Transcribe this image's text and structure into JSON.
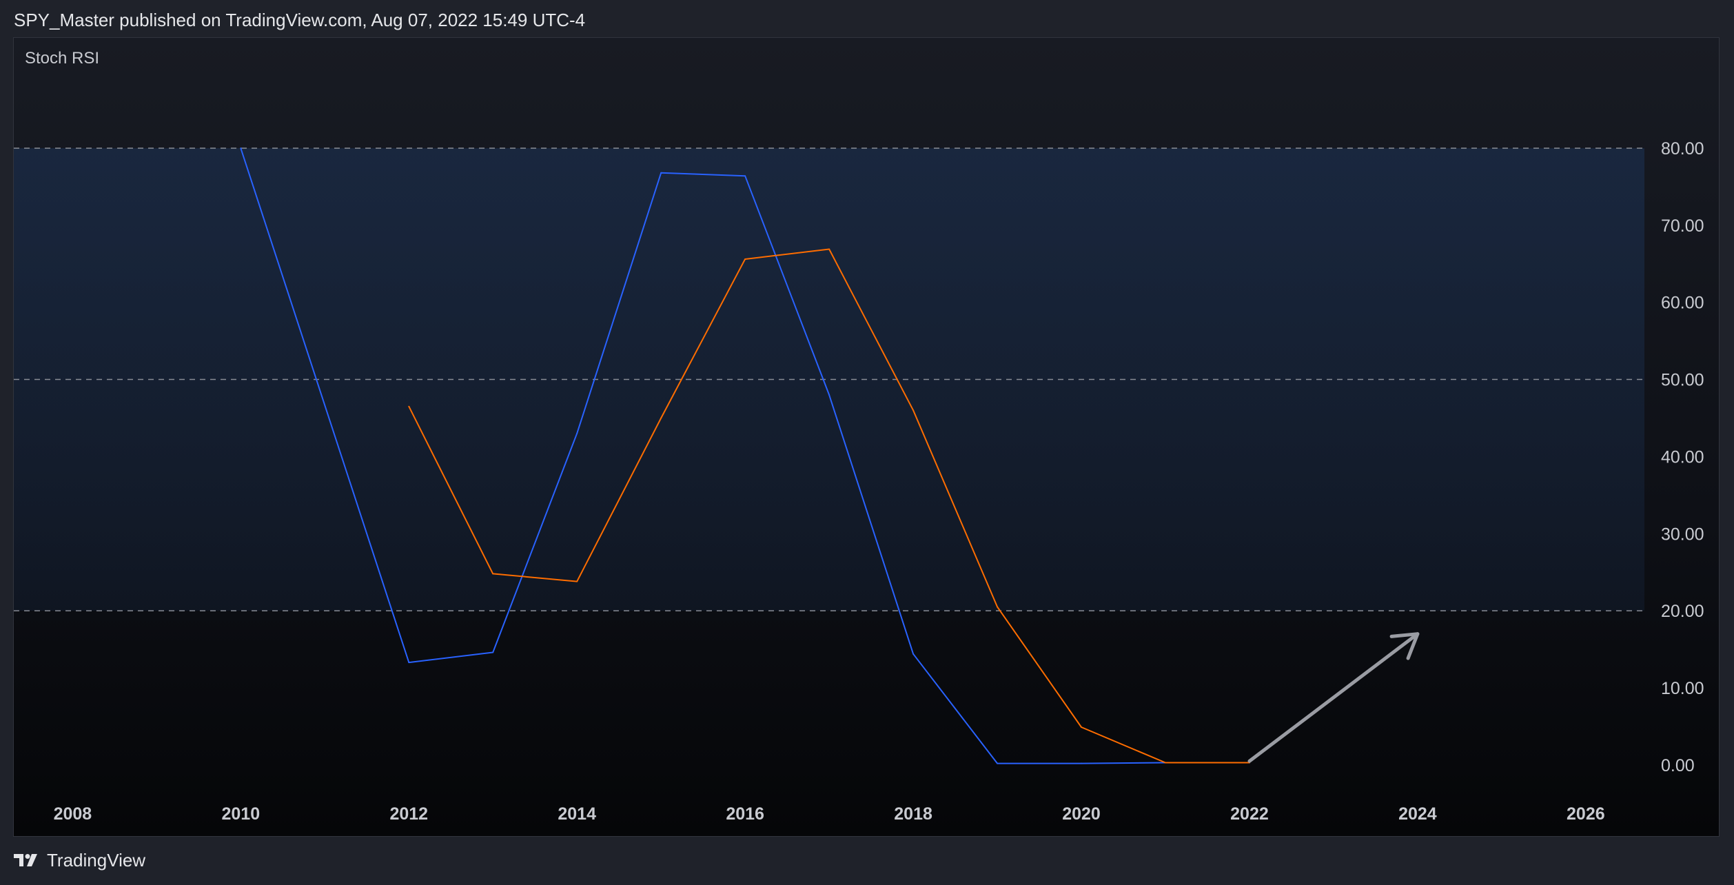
{
  "header": {
    "text": "SPY_Master published on TradingView.com, Aug 07, 2022 15:49 UTC-4"
  },
  "indicator": {
    "label": "Stoch RSI"
  },
  "footer": {
    "logo_icon": "tradingview-logo-icon",
    "brand": "TradingView"
  },
  "colors": {
    "k_line": "#2962ff",
    "d_line": "#ff6d00",
    "band_fill": "#1c3357",
    "dashed_lines": "#8a8d96",
    "arrow": "#9a9ca3",
    "axis_text": "#c9cbd1"
  },
  "chart_data": {
    "type": "line",
    "title": "Stoch RSI",
    "xlabel": "",
    "ylabel": "",
    "xlim": [
      2007.3,
      2027.6
    ],
    "ylim": [
      -9.4,
      94.3
    ],
    "x_ticks": [
      2008,
      2010,
      2012,
      2014,
      2016,
      2018,
      2020,
      2022,
      2024,
      2026
    ],
    "x_tick_labels": [
      "2008",
      "2010",
      "2012",
      "2014",
      "2016",
      "2018",
      "2020",
      "2022",
      "2024",
      "2026"
    ],
    "y_ticks": [
      80,
      70,
      60,
      50,
      40,
      30,
      20,
      10,
      0
    ],
    "y_tick_labels": [
      "80.00",
      "70.00",
      "60.00",
      "50.00",
      "40.00",
      "30.00",
      "20.00",
      "10.00",
      "0.00"
    ],
    "hlines": [
      80,
      50,
      20
    ],
    "band": [
      20,
      80
    ],
    "grid": false,
    "series": [
      {
        "color": "#2962ff",
        "x": [
          2010,
          2012,
          2013,
          2014,
          2015,
          2016,
          2017,
          2018,
          2019,
          2020,
          2021,
          2022
        ],
        "y": [
          80,
          13.3,
          14.6,
          43,
          76.8,
          76.4,
          48,
          14.4,
          0.2,
          0.2,
          0.3,
          0.3
        ]
      },
      {
        "color": "#ff6d00",
        "x": [
          2012,
          2013,
          2014,
          2015,
          2016,
          2017,
          2018,
          2019,
          2020,
          2021,
          2022
        ],
        "y": [
          46.5,
          24.8,
          23.8,
          45,
          65.6,
          66.9,
          46,
          20.5,
          4.9,
          0.3,
          0.3
        ]
      }
    ],
    "annotations": [
      {
        "type": "arrow",
        "color": "#9a9ca3",
        "from": [
          2022,
          0.5
        ],
        "to": [
          2024,
          17
        ]
      }
    ]
  }
}
